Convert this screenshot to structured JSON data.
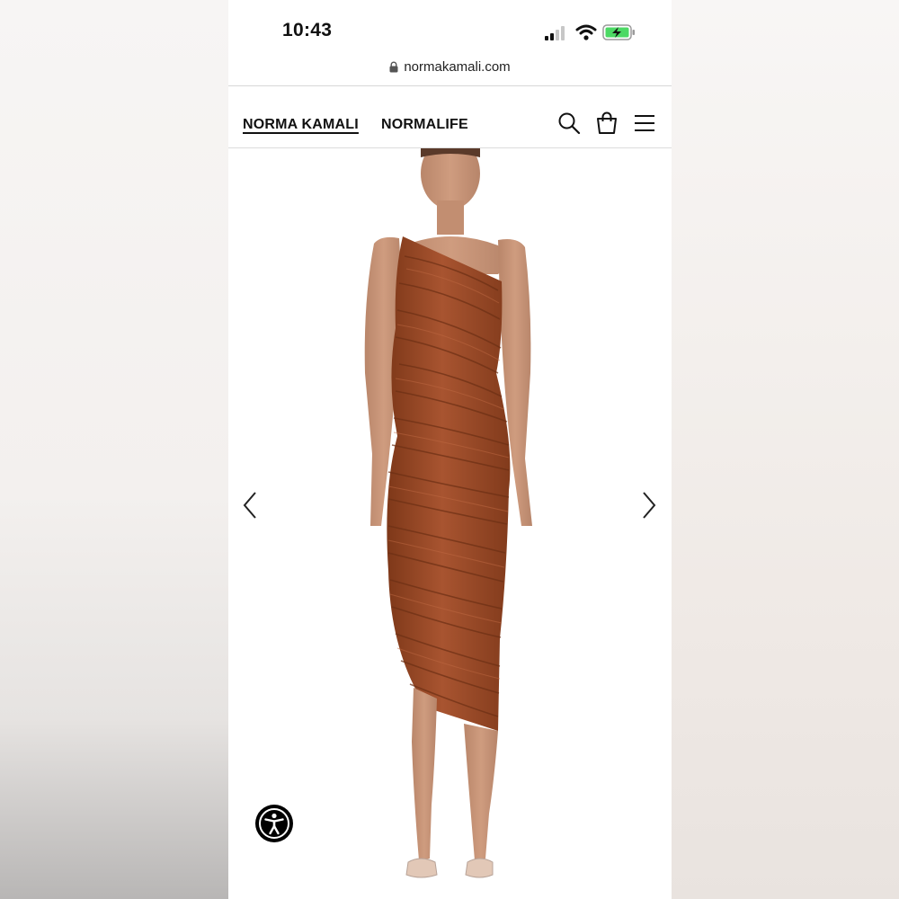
{
  "status_bar": {
    "time": "10:43",
    "icons": [
      "signal-icon",
      "wifi-icon",
      "battery-charging-icon"
    ]
  },
  "browser": {
    "url": "normakamali.com",
    "icons": [
      "lock-icon"
    ]
  },
  "header": {
    "brand": "NORMA KAMALI",
    "secondary_nav": "NORMALIFE",
    "icons": [
      "search-icon",
      "shopping-bag-icon",
      "menu-icon"
    ]
  },
  "product_gallery": {
    "image": "model wearing rust one-shoulder ruched midi dress",
    "controls": [
      "chevron-left-icon",
      "chevron-right-icon"
    ]
  },
  "accessibility": {
    "icon": "accessibility-icon"
  },
  "colors": {
    "dress": "#9c4a26",
    "accent": "#111111",
    "battery": "#4cd964"
  }
}
